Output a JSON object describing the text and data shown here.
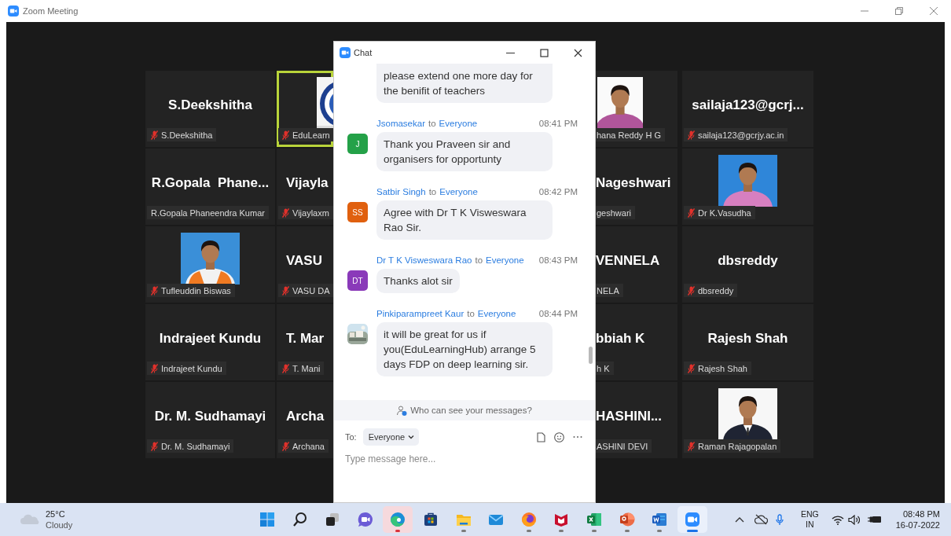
{
  "window": {
    "title": "Zoom Meeting"
  },
  "gallery": {
    "rows": [
      {
        "tiles": [
          {
            "kind": "name",
            "name": "S.Deekshitha",
            "label": "S.Deekshitha",
            "muted": true,
            "speaking": false
          },
          {
            "kind": "picture",
            "label": "EduLearn",
            "muted": true,
            "speaking": true
          },
          {
            "kind": "picture",
            "label": "hana Reddy H G",
            "muted": false,
            "speaking": false
          },
          {
            "kind": "name",
            "name": "sailaja123@gcrj...",
            "label": "sailaja123@gcrjy.ac.in",
            "muted": true,
            "speaking": false
          }
        ]
      },
      {
        "tiles": [
          {
            "kind": "name",
            "name": "R.Gopala  Phane...",
            "label": "R.Gopala Phaneendra Kumar",
            "muted": false,
            "speaking": false
          },
          {
            "kind": "name",
            "name": "Vijayla",
            "label": "Vijaylaxm",
            "muted": true,
            "speaking": false
          },
          {
            "kind": "name",
            "name": "Nageshwari",
            "label": "geshwari",
            "muted": false,
            "speaking": false
          },
          {
            "kind": "picture",
            "label": "Dr K.Vasudha",
            "muted": true,
            "speaking": false
          }
        ]
      },
      {
        "tiles": [
          {
            "kind": "picture",
            "label": "Tufleuddin Biswas",
            "muted": true,
            "speaking": false
          },
          {
            "kind": "name",
            "name": "VASU",
            "label": "VASU DA",
            "muted": true,
            "speaking": false
          },
          {
            "kind": "name",
            "name": "VENNELA",
            "label": "NELA",
            "muted": false,
            "speaking": false
          },
          {
            "kind": "name",
            "name": "dbsreddy",
            "label": "dbsreddy",
            "muted": true,
            "speaking": false
          }
        ]
      },
      {
        "tiles": [
          {
            "kind": "name",
            "name": "Indrajeet Kundu",
            "label": "Indrajeet Kundu",
            "muted": true,
            "speaking": false
          },
          {
            "kind": "name",
            "name": "T. Mar",
            "label": "T. Mani",
            "muted": true,
            "speaking": false
          },
          {
            "kind": "name",
            "name": "bbiah K",
            "label": "h K",
            "muted": false,
            "speaking": false
          },
          {
            "kind": "name",
            "name": "Rajesh Shah",
            "label": "Rajesh Shah",
            "muted": true,
            "speaking": false
          }
        ]
      },
      {
        "tiles": [
          {
            "kind": "name",
            "name": "Dr. M. Sudhamayi",
            "label": "Dr. M. Sudhamayi",
            "muted": true,
            "speaking": false
          },
          {
            "kind": "name",
            "name": "Archa",
            "label": "Archana",
            "muted": true,
            "speaking": false
          },
          {
            "kind": "name",
            "name": "HASHINI...",
            "label": "ASHINI DEVI",
            "muted": false,
            "speaking": false
          },
          {
            "kind": "picture",
            "label": "Raman Rajagopalan",
            "muted": true,
            "speaking": false
          }
        ]
      }
    ]
  },
  "chat": {
    "title": "Chat",
    "messages": [
      {
        "kind": "continuation",
        "text": "please extend one more day for the benifit of teachers"
      },
      {
        "kind": "message",
        "sender": "Jsomasekar",
        "to": "to",
        "recipient": "Everyone",
        "time": "08:41 PM",
        "avatar": {
          "kind": "initials",
          "text": "J",
          "color": "#24a148"
        },
        "text": "Thank you Praveen sir and organisers for opportunty"
      },
      {
        "kind": "message",
        "sender": "Satbir Singh",
        "to": "to",
        "recipient": "Everyone",
        "time": "08:42 PM",
        "avatar": {
          "kind": "initials",
          "text": "SS",
          "color": "#e0600f"
        },
        "text": "Agree with Dr T K Visweswara Rao Sir."
      },
      {
        "kind": "message",
        "sender": "Dr T K Visweswara Rao",
        "to": "to",
        "recipient": "Everyone",
        "time": "08:43 PM",
        "avatar": {
          "kind": "initials",
          "text": "DT",
          "color": "#8a3ab9"
        },
        "text": "Thanks alot sir"
      },
      {
        "kind": "message",
        "sender": "Pinkiparampreet Kaur",
        "to": "to",
        "recipient": "Everyone",
        "time": "08:44 PM",
        "text": "it will be great for us if you(EduLearningHub) arrange 5 days FDP on deep learning sir."
      }
    ],
    "privacy_note": "Who can see your messages?",
    "to_label": "To:",
    "recipient": "Everyone",
    "placeholder": "Type message here..."
  },
  "taskbar": {
    "weather": {
      "temperature": "25°C",
      "condition": "Cloudy"
    },
    "apps": [
      {
        "kind": "start",
        "running": false,
        "selected": false,
        "flashing": false
      },
      {
        "kind": "search",
        "running": false,
        "selected": false,
        "flashing": false
      },
      {
        "kind": "taskview",
        "running": false,
        "selected": false,
        "flashing": false
      },
      {
        "kind": "teams",
        "running": false,
        "selected": false,
        "flashing": false
      },
      {
        "kind": "edge",
        "running": true,
        "selected": false,
        "flashing": true
      },
      {
        "kind": "store",
        "running": false,
        "selected": false,
        "flashing": false
      },
      {
        "kind": "explorer",
        "running": true,
        "selected": false,
        "flashing": false
      },
      {
        "kind": "mail",
        "running": false,
        "selected": false,
        "flashing": false
      },
      {
        "kind": "firefox",
        "running": true,
        "selected": false,
        "flashing": false
      },
      {
        "kind": "mcafee",
        "running": true,
        "selected": false,
        "flashing": false
      },
      {
        "kind": "excel",
        "running": true,
        "selected": false,
        "flashing": false
      },
      {
        "kind": "powerpoint",
        "running": true,
        "selected": false,
        "flashing": false
      },
      {
        "kind": "word",
        "running": true,
        "selected": false,
        "flashing": false
      },
      {
        "kind": "zoom",
        "running": true,
        "selected": true,
        "flashing": false
      }
    ],
    "tray": {
      "language": "ENG",
      "region": "IN",
      "time": "08:48 PM",
      "date": "16-07-2022"
    }
  }
}
